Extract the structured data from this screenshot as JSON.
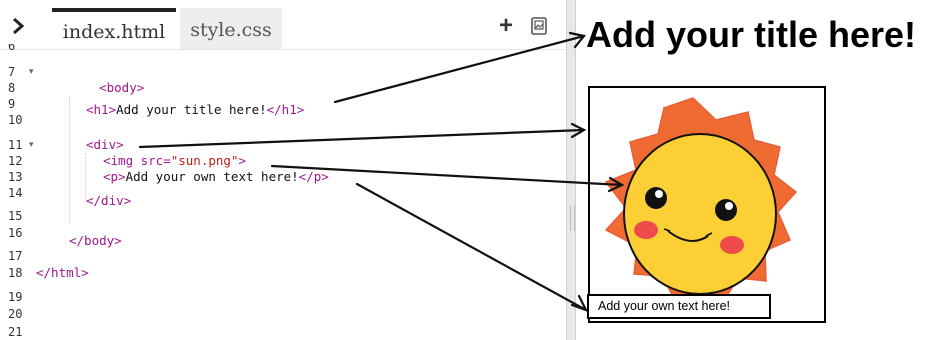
{
  "editor": {
    "tabs": [
      {
        "label": "index.html",
        "active": true
      },
      {
        "label": "style.css",
        "active": false
      }
    ],
    "add_file_label": "+",
    "icons": {
      "collapse": "chevron-right-icon",
      "add": "plus-icon",
      "image": "image-icon"
    },
    "line_numbers": [
      "6",
      "7",
      "8",
      "9",
      "10",
      "11",
      "12",
      "13",
      "14",
      "15",
      "16",
      "17",
      "18",
      "19",
      "20",
      "21"
    ],
    "code": {
      "body_open": "<body>",
      "h1_open": "<h1>",
      "h1_text": "Add your title here!",
      "h1_close": "</h1>",
      "div_open": "<div>",
      "img_open": "<img src=",
      "img_src": "\"sun.png\"",
      "img_close": ">",
      "p_open": "<p>",
      "p_text": "Add your own text here!",
      "p_close": "</p>",
      "div_close": "</div>",
      "body_close": "</body>",
      "html_close": "</html>"
    }
  },
  "preview": {
    "title": "Add your title here!",
    "paragraph": "Add your own text here!",
    "image_alt": "sun.png"
  },
  "colors": {
    "tag": "#a0178e",
    "string": "#c41a16",
    "sun_rays": "#ef6b32",
    "sun_face": "#fcd034",
    "cheeks": "#ee4b4b"
  }
}
